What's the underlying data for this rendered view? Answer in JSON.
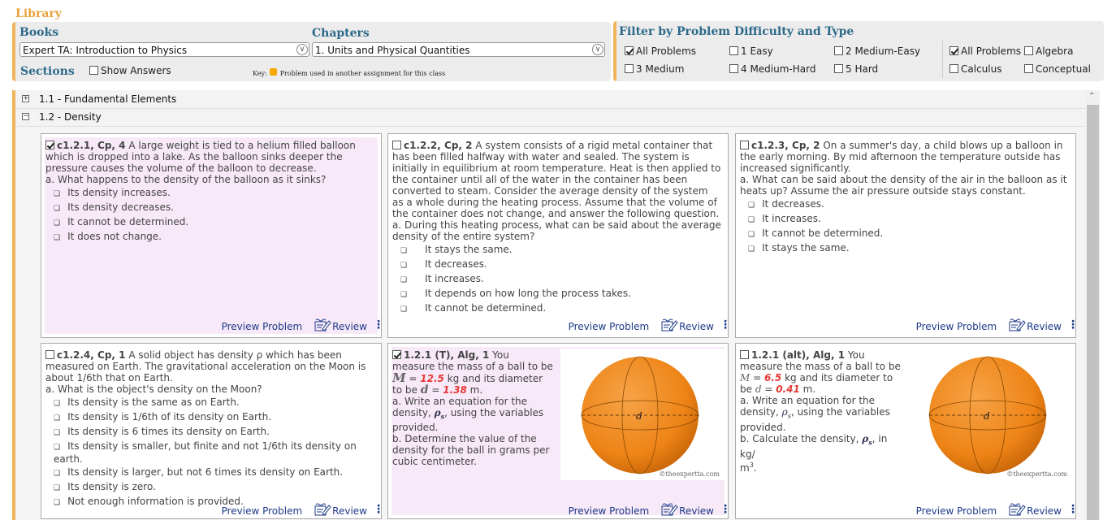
{
  "library": {
    "title": "Library"
  },
  "books": {
    "label": "Books",
    "selected": "Expert TA:  Introduction to Physics"
  },
  "chapters": {
    "label": "Chapters",
    "selected": "1. Units and Physical Quantities"
  },
  "sections": {
    "label": "Sections",
    "show_answers": "Show Answers",
    "show_answers_checked": false
  },
  "key": {
    "label": "Key:",
    "text": "Problem used in another assignment for this class",
    "color": "#f5a800"
  },
  "filter": {
    "title": "Filter by Problem Difficulty and Type",
    "difficulty": [
      {
        "label": "All Problems",
        "checked": true
      },
      {
        "label": "1 Easy",
        "checked": false
      },
      {
        "label": "2 Medium-Easy",
        "checked": false
      },
      {
        "label": "3 Medium",
        "checked": false
      },
      {
        "label": "4 Medium-Hard",
        "checked": false
      },
      {
        "label": "5 Hard",
        "checked": false
      }
    ],
    "types": [
      {
        "label": "All Problems",
        "checked": true
      },
      {
        "label": "Algebra",
        "checked": false
      },
      {
        "label": "Calculus",
        "checked": false
      },
      {
        "label": "Conceptual",
        "checked": false
      }
    ]
  },
  "outline": [
    {
      "toggle": "⊞",
      "label": "1.1 - Fundamental Elements"
    },
    {
      "toggle": "⊟",
      "label": "1.2 - Density"
    }
  ],
  "cards": [
    {
      "id": "c1.2.1, Cp, 4",
      "checked": true,
      "used": true,
      "text": "A large weight is tied to a helium filled balloon which is dropped into a lake. As the balloon sinks deeper the pressure causes the volume of the balloon to decrease.",
      "question": "a. What happens to the density of the balloon as it sinks?",
      "options": [
        "Its density increases.",
        "Its density decreases.",
        "It cannot be determined.",
        "It does not change."
      ]
    },
    {
      "id": "c1.2.2, Cp, 2",
      "checked": false,
      "used": false,
      "text": "A system consists of a rigid metal container that has been filled halfway with water and sealed. The system is initially in equilibrium at room temperature. Heat is then applied to the container until all of the water in the container has been converted to steam. Consider the average density of the system as a whole during the heating process. Assume that the volume of the container does not change, and answer the following question.",
      "question": "a. During this heating process, what can be said about the average density of the entire system?",
      "options": [
        "It stays the same.",
        "It decreases.",
        "It increases.",
        "It depends on how long the process takes.",
        "It cannot be determined."
      ]
    },
    {
      "id": "c1.2.3, Cp, 2",
      "checked": false,
      "used": false,
      "text": "On a summer's day, a child blows up a balloon in the early morning. By mid afternoon the temperature outside has increased significantly.",
      "question": "a. What can be said about the density of the air in the balloon as it heats up? Assume the air pressure outside stays constant.",
      "options": [
        "It decreases.",
        "It increases.",
        "It cannot be determined.",
        "It stays the same."
      ]
    },
    {
      "id": "c1.2.4, Cp, 1",
      "checked": false,
      "used": false,
      "text": "A solid object has density ρ which has been measured on Earth. The gravitational acceleration on the Moon is about 1/6th that on Earth.",
      "question": "a. What is the object's density on the Moon?",
      "options": [
        "Its density is the same as on Earth.",
        "Its density is 1/6th of its density on Earth.",
        "Its density is 6 times its density on Earth.",
        "Its density is smaller, but finite and not 1/6th its density on earth.",
        "Its density is larger, but not 6 times its density on Earth.",
        "Its density is zero.",
        "Not enough information is provided."
      ]
    },
    {
      "id": "1.2.1 (T), Alg, 1",
      "checked": true,
      "used": true,
      "t1": "You measure the mass of a ball to be",
      "mvar": "M",
      "mval": "12.5",
      "t2": "kg and its diameter to be",
      "dval": "1.38",
      "t3": "m.",
      "qa": "a. Write an equation for the density, ",
      "qa2": ", using the variables provided.",
      "qb": "b. Determine the value of the density for the ball in grams per cubic centimeter.",
      "copyright": "©theexpertta.com"
    },
    {
      "id": "1.2.1 (alt), Alg, 1",
      "checked": false,
      "used": false,
      "t1": "You measure the mass of a ball to be",
      "mvar": "M",
      "mval": "6.5",
      "t2": "kg and its diameter to be",
      "dval": "0.41",
      "t3": "m.",
      "qa": "a. Write an equation for the density, ",
      "qa2": ", using the variables provided.",
      "qb": "b. Calculate the density, ",
      "qb2": ", in kg/",
      "copyright": "©theexpertta.com"
    }
  ],
  "actions": {
    "preview": "Preview Problem",
    "review": "Review",
    "more": "⋮"
  },
  "figure": {
    "diameter_label": "d",
    "ball_color": "#f08a1c"
  }
}
